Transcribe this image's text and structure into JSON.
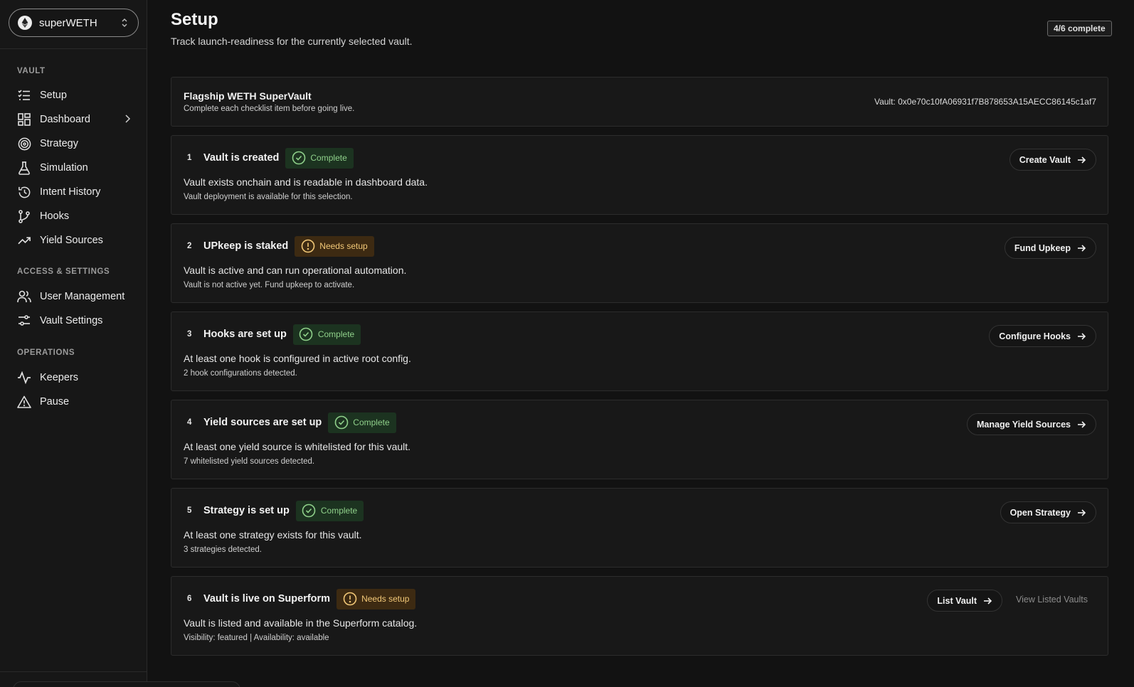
{
  "vault_selector": {
    "label": "superWETH",
    "icon": "ethereum-icon"
  },
  "sidebar": {
    "sections": [
      {
        "label": "VAULT"
      },
      {
        "label": "ACCESS & SETTINGS"
      },
      {
        "label": "OPERATIONS"
      }
    ],
    "items": [
      {
        "label": "Setup",
        "icon": "checklist-icon"
      },
      {
        "label": "Dashboard",
        "icon": "grid-icon"
      },
      {
        "label": "Strategy",
        "icon": "target-icon"
      },
      {
        "label": "Simulation",
        "icon": "flask-icon"
      },
      {
        "label": "Intent History",
        "icon": "history-icon"
      },
      {
        "label": "Hooks",
        "icon": "branch-icon"
      },
      {
        "label": "Yield Sources",
        "icon": "trend-up-icon"
      },
      {
        "label": "User Management",
        "icon": "users-icon"
      },
      {
        "label": "Vault Settings",
        "icon": "sliders-icon"
      },
      {
        "label": "Keepers",
        "icon": "activity-icon"
      },
      {
        "label": "Pause",
        "icon": "warning-icon"
      }
    ]
  },
  "header": {
    "title": "Setup",
    "subtitle": "Track launch-readiness for the currently selected vault.",
    "progress": "4/6 complete"
  },
  "vault_card": {
    "title": "Flagship WETH SuperVault",
    "subtitle": "Complete each checklist item before going live.",
    "address": "Vault: 0x0e70c10fA06931f7B878653A15AECC86145c1af7"
  },
  "steps": [
    {
      "num": "1",
      "title": "Vault is created",
      "status": "Complete",
      "desc": "Vault exists onchain and is readable in dashboard data.",
      "detail": "Vault deployment is available for this selection.",
      "action": "Create Vault"
    },
    {
      "num": "2",
      "title": "UPkeep is staked",
      "status": "Needs setup",
      "desc": "Vault is active and can run operational automation.",
      "detail": "Vault is not active yet. Fund upkeep to activate.",
      "action": "Fund Upkeep"
    },
    {
      "num": "3",
      "title": "Hooks are set up",
      "status": "Complete",
      "desc": "At least one hook is configured in active root config.",
      "detail": "2 hook configurations detected.",
      "action": "Configure Hooks"
    },
    {
      "num": "4",
      "title": "Yield sources are set up",
      "status": "Complete",
      "desc": "At least one yield source is whitelisted for this vault.",
      "detail": "7 whitelisted yield sources detected.",
      "action": "Manage Yield Sources"
    },
    {
      "num": "5",
      "title": "Strategy is set up",
      "status": "Complete",
      "desc": "At least one strategy exists for this vault.",
      "detail": "3 strategies detected.",
      "action": "Open Strategy"
    },
    {
      "num": "6",
      "title": "Vault is live on Superform",
      "status": "Needs setup",
      "desc": "Vault is listed and available in the Superform catalog.",
      "detail": "Visibility: featured | Availability: available",
      "action": "List Vault",
      "secondary_action": "View Listed Vaults"
    }
  ],
  "colors": {
    "background": "#121212",
    "complete_bg": "#1c3320",
    "complete_fg": "#8fd08a",
    "warn_bg": "#3d2a12",
    "warn_fg": "#f2c877"
  }
}
